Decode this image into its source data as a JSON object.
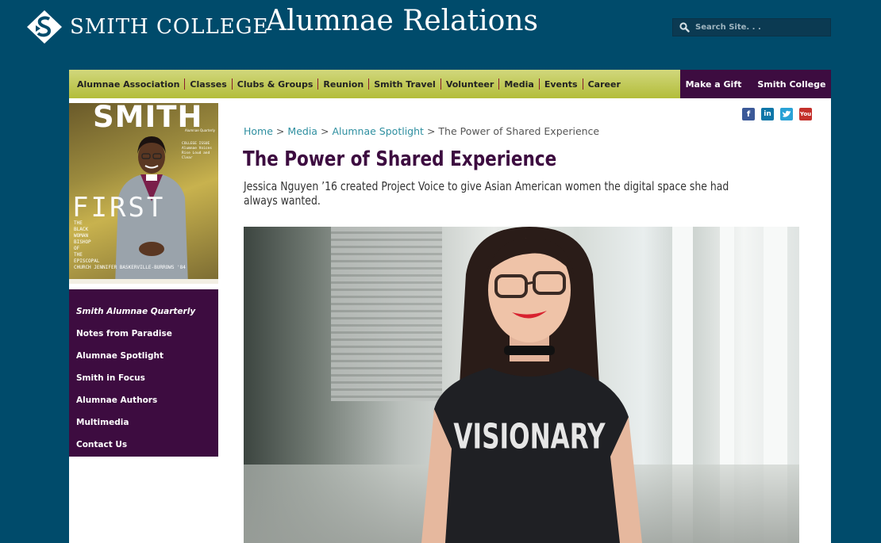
{
  "header": {
    "college_name": "SMITH COLLEGE",
    "site_name": "Alumnae Relations",
    "search_placeholder": "Search Site. . ."
  },
  "nav": {
    "items": [
      "Alumnae Association",
      "Classes",
      "Clubs & Groups",
      "Reunion",
      "Smith Travel",
      "Volunteer",
      "Media",
      "Events",
      "Career"
    ],
    "utility": [
      "Make a Gift",
      "Smith College"
    ]
  },
  "cover": {
    "title": "SMITH",
    "subtitle": "Alumnae Quarterly",
    "headline": "FIRST",
    "tagline": [
      "THE",
      "BLACK",
      "WOMAN",
      "BISHOP",
      "OF",
      "THE",
      "EPISCOPAL",
      "CHURCH JENNIFER BASKERVILLE-BURROWS '84"
    ],
    "teaser": "COLLEGE ISSUE Alumnae Voices Rise Loud and Clear"
  },
  "sidebar": {
    "items": [
      "Smith Alumnae Quarterly",
      "Notes from Paradise",
      "Alumnae Spotlight",
      "Smith in Focus",
      "Alumnae Authors",
      "Multimedia",
      "Contact Us"
    ]
  },
  "social": {
    "icons": [
      "facebook-icon",
      "linkedin-icon",
      "twitter-icon",
      "youtube-icon"
    ],
    "colors": {
      "facebook": "#3b5998",
      "linkedin": "#0e76a8",
      "twitter": "#2aa2d6",
      "youtube": "#c4302b"
    }
  },
  "breadcrumb": {
    "links": [
      "Home",
      "Media",
      "Alumnae Spotlight"
    ],
    "current": "The Power of Shared Experience",
    "separator": ">"
  },
  "article": {
    "title": "The Power of Shared Experience",
    "subtitle": "Jessica Nguyen ’16 created Project Voice to give Asian American women the digital space she had always wanted.",
    "shirt_text": "VISIONARY"
  },
  "colors": {
    "background": "#004b6b",
    "nav_green": "#c4ca5a",
    "brand_purple": "#3d0c40",
    "link_teal": "#2e8fa0"
  }
}
